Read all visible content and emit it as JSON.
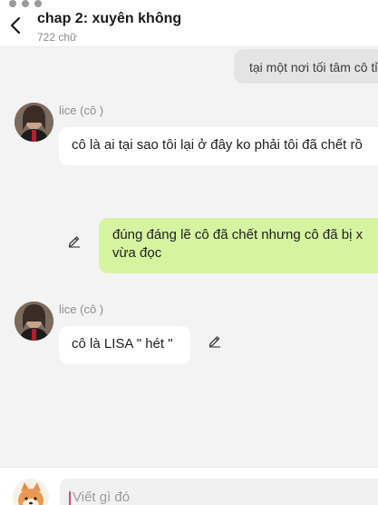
{
  "header": {
    "title": "chap 2: xuyên không",
    "subtitle": "722 chữ"
  },
  "messages": [
    {
      "type": "outgoing",
      "style": "gray",
      "text": "tại một nơi tối tâm cô tỉ"
    },
    {
      "type": "incoming",
      "sender": "lice (cô )",
      "text": "cô là ai tại sao tôi lại ở đây ko phải tôi đã chết rồ"
    },
    {
      "type": "outgoing",
      "style": "green",
      "lines": [
        "đúng đáng lẽ cô đã chết nhưng  cô đã bị x",
        "vừa đọc"
      ]
    },
    {
      "type": "incoming",
      "sender": "lice (cô )",
      "text": "cô là LISA \" hét \""
    }
  ],
  "composer": {
    "placeholder": "Viết gì đó"
  },
  "colors": {
    "background": "#f3f3f3",
    "outgoing_green": "#d6f3a0",
    "outgoing_gray": "#e4e4e4",
    "incoming": "#ffffff",
    "caret": "#e0457b"
  },
  "icons": {
    "back": "chevron-left-icon",
    "edit": "pencil-icon"
  }
}
